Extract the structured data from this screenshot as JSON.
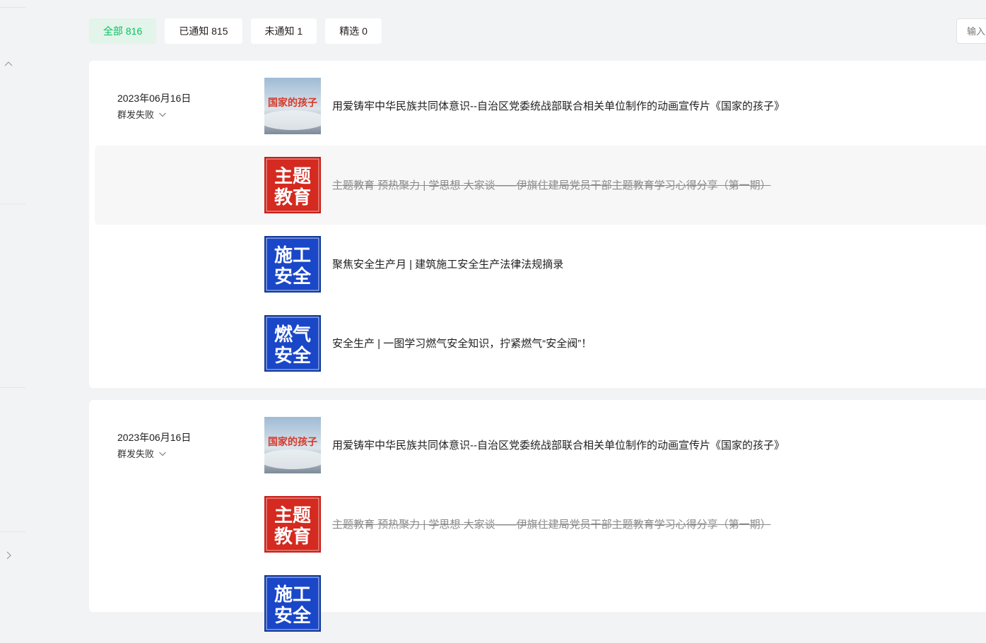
{
  "filters": [
    {
      "label": "全部 816",
      "active": true
    },
    {
      "label": "已通知 815",
      "active": false
    },
    {
      "label": "未通知 1",
      "active": false
    },
    {
      "label": "精选 0",
      "active": false
    }
  ],
  "search": {
    "placeholder": "输入"
  },
  "groups": [
    {
      "date": "2023年06月16日",
      "status": "群发失败",
      "articles": [
        {
          "title": "用爱铸牢中华民族共同体意识--自治区党委统战部联合相关单位制作的动画宣传片《国家的孩子》",
          "thumb_text": "国家的孩子",
          "deleted": false
        },
        {
          "title": "主题教育 预热聚力 | 学思想 大家谈——伊旗住建局党员干部主题教育学习心得分享（第一期）",
          "thumb_text": [
            "主题",
            "教育"
          ],
          "deleted": true
        },
        {
          "title": "聚焦安全生产月 | 建筑施工安全生产法律法规摘录",
          "thumb_text": [
            "施工",
            "安全"
          ],
          "deleted": false
        },
        {
          "title": "安全生产 | 一图学习燃气安全知识，拧紧燃气“安全阀”！",
          "thumb_text": [
            "燃气",
            "安全"
          ],
          "deleted": false
        }
      ]
    },
    {
      "date": "2023年06月16日",
      "status": "群发失败",
      "articles": [
        {
          "title": "用爱铸牢中华民族共同体意识--自治区党委统战部联合相关单位制作的动画宣传片《国家的孩子》",
          "thumb_text": "国家的孩子",
          "deleted": false
        },
        {
          "title": "主题教育 预热聚力 | 学思想 大家谈——伊旗住建局党员干部主题教育学习心得分享（第一期）",
          "thumb_text": [
            "主题",
            "教育"
          ],
          "deleted": true
        },
        {
          "title": "",
          "thumb_text": [
            "施工",
            "安全"
          ],
          "deleted": false
        }
      ]
    }
  ],
  "icons": {
    "collapse": "chevron-up-icon",
    "expand": "chevron-right-icon",
    "status_toggle": "chevron-down-icon"
  },
  "colors": {
    "accent": "#07c160",
    "accent_bg": "#e3f4ea",
    "red_thumb": "#d42a20",
    "blue_thumb": "#1a47c8"
  }
}
